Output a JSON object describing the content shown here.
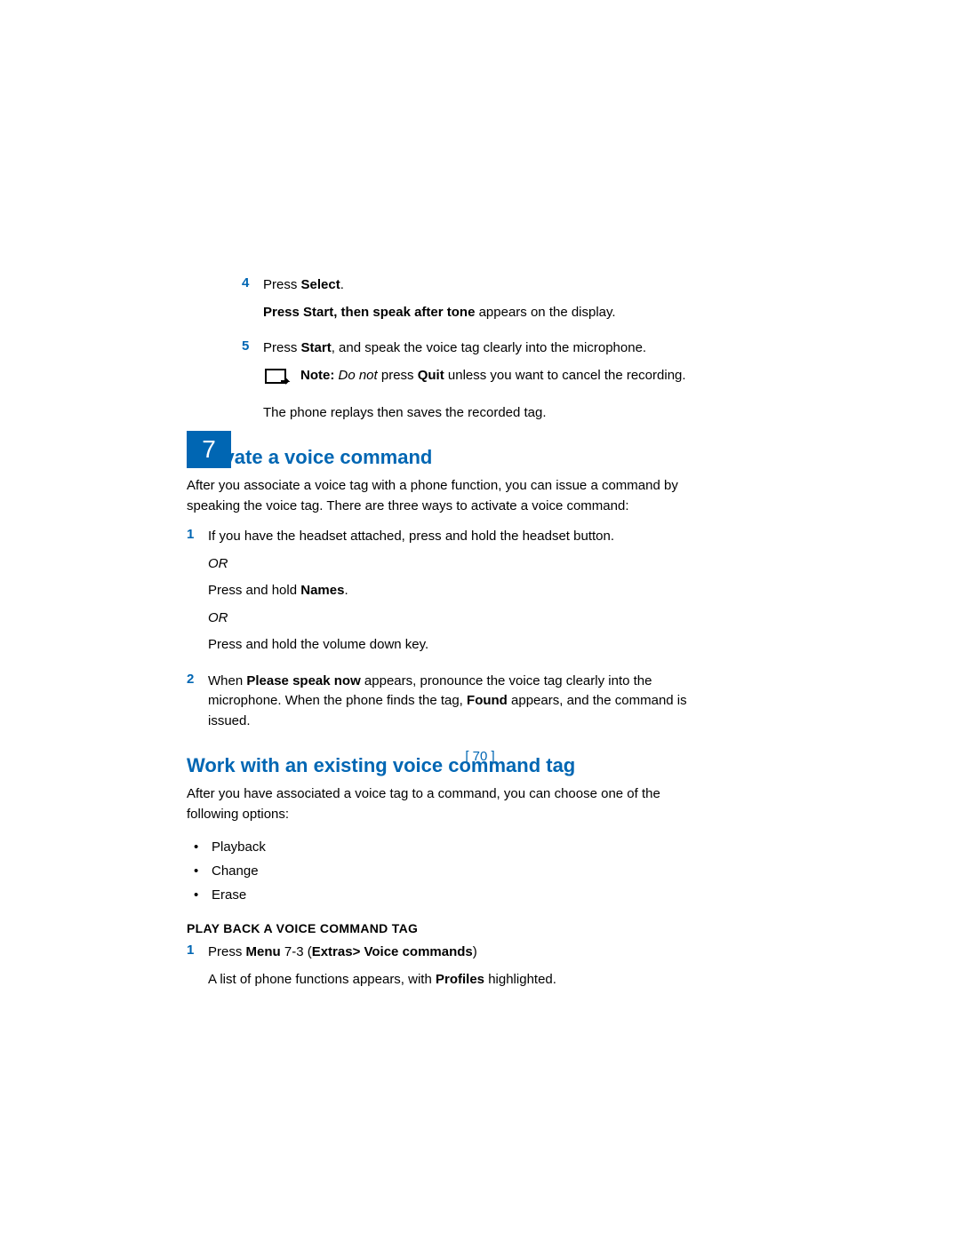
{
  "chapter_num": "7",
  "step4": {
    "num": "4",
    "press": "Press ",
    "select": "Select",
    "period": ".",
    "display_msg_bold": "Press Start, then speak after tone",
    "display_msg_rest": " appears on the display."
  },
  "step5": {
    "num": "5",
    "press": "Press ",
    "start": "Start",
    "rest": ", and speak the voice tag clearly into the microphone.",
    "note_label": "Note:",
    "note_donot": " Do not",
    "note_press": " press ",
    "note_quit": "Quit",
    "note_rest": " unless you want to cancel the recording.",
    "replay": "The phone replays then saves the recorded tag."
  },
  "section1": {
    "heading": "Activate a voice command",
    "intro": "After you associate a voice tag with a phone function, you can issue a command by speaking the voice tag. There are three ways to activate a voice command:",
    "s1_num": "1",
    "s1_text": "If you have the headset attached, press and hold the headset button.",
    "or1": "OR",
    "s1_alt1a": "Press and hold ",
    "s1_alt1b": "Names",
    "s1_alt1c": ".",
    "or2": "OR",
    "s1_alt2": "Press and hold the volume down key.",
    "s2_num": "2",
    "s2_a": "When ",
    "s2_b": "Please speak now",
    "s2_c": " appears, pronounce the voice tag clearly into the microphone. When the phone finds the tag, ",
    "s2_d": "Found",
    "s2_e": " appears, and the command is issued."
  },
  "section2": {
    "heading": "Work with an existing voice command tag",
    "intro": "After you have associated a voice tag to a command, you can choose one of the following options:",
    "bullets": {
      "b1": "Playback",
      "b2": "Change",
      "b3": "Erase"
    },
    "subheading": "PLAY BACK A VOICE COMMAND TAG",
    "pb_num": "1",
    "pb_a": "Press ",
    "pb_b": "Menu",
    "pb_c": " 7-3 (",
    "pb_d": "Extras> Voice commands",
    "pb_e": ")",
    "pb_line2a": "A list of phone functions appears, with ",
    "pb_line2b": "Profiles",
    "pb_line2c": " highlighted."
  },
  "page_number": "[ 70 ]"
}
